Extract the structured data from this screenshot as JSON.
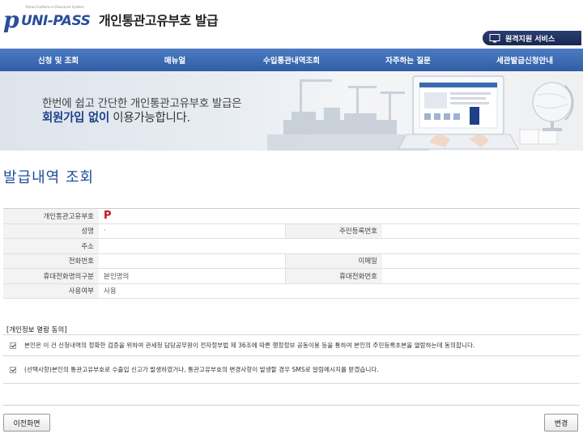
{
  "header": {
    "logo_subtitle": "Korea Customs e-Clearance System",
    "logo_mark": "p",
    "logo_text": "UNI-PASS",
    "site_title": "개인통관고유부호 발급",
    "remote_support_label": "원격지원 서비스"
  },
  "nav": {
    "items": [
      {
        "label": "신청 및 조회"
      },
      {
        "label": "매뉴얼"
      },
      {
        "label": "수입통관내역조회"
      },
      {
        "label": "자주하는 질문"
      },
      {
        "label": "세관발급신청안내"
      }
    ]
  },
  "banner": {
    "line1": "한번에 쉽고 간단한 개인통관고유부호 발급은",
    "line2_bold": "회원가입 없이",
    "line2_rest": " 이용가능합니다."
  },
  "page": {
    "title": "발급내역 조회"
  },
  "info": {
    "code_label": "개인통관고유부호",
    "code_value": "P",
    "name_label": "성명",
    "name_value": "·",
    "rrn_label": "주민등록번호",
    "rrn_value": "",
    "address_label": "주소",
    "address_value": "",
    "phone_label": "전화번호",
    "phone_value": "",
    "email_label": "이메일",
    "email_value": "",
    "mobile_owner_label": "휴대전화명의구분",
    "mobile_owner_value": "본인명의",
    "mobile_label": "휴대전화번호",
    "mobile_value": "",
    "usage_label": "사용여부",
    "usage_value": "사용"
  },
  "consent": {
    "title": "[개인정보 열람 동의]",
    "items": [
      {
        "text": "본인은 이 건 신청내역의 정확한 검증을 위하여 관세청 담당공무원이 전자정부법 제 36조에 따른 행정정보 공동이용 등을 통하여 본인의 주민등록초본을 열람하는데 동의합니다.",
        "checked": true
      },
      {
        "text": "(선택사항)본인의 통관고유부호로 수출입 신고가 발생하였거나, 통관고유부호의 변경사항이 발생할 경우 SMS로 알림메시지를 받겠습니다.",
        "checked": true
      }
    ]
  },
  "buttons": {
    "prev_label": "이전화면",
    "edit_label": "변경"
  },
  "colors": {
    "nav_bg": "#3a69b0",
    "title_blue": "#1f4a99",
    "code_red": "#c0141c",
    "remote_btn": "#1f3360"
  }
}
